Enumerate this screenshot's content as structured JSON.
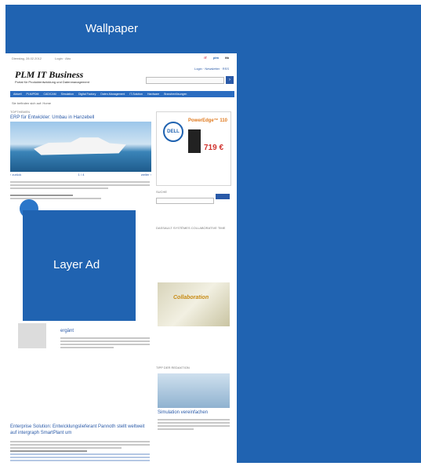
{
  "wallpaper": {
    "label": "Wallpaper"
  },
  "layer_ad": {
    "label": "Layer Ad"
  },
  "site": {
    "brand": "PLM IT Business",
    "tagline": "Portal für Produktentwicklung und Datenmanagement",
    "nav_items": [
      "Aktuell",
      "PLM/PDM",
      "CAD/CAM",
      "Simulation",
      "Digital Factory",
      "Daten-Management",
      "IT-Solution",
      "Hardware",
      "Branchenlösungen"
    ],
    "hero_section_label": "TOPTHEMEN",
    "hero_headline": "ERP für Entwickler: Umbau in Hanzebell",
    "enterprise_headline": "Enterprise Solution: Entwicklungslieferant Pannoth stellt weltweit auf intergraph SmartPlant um",
    "product_headline": "ergänt",
    "tipp_caption": "Simulation vereinfachen",
    "ad_dell": {
      "brand": "DELL",
      "product": "PowerEdge™ 110",
      "price": "719 €"
    },
    "suche_label": "SUCHE",
    "collaboration_label": "DASSAULT SYSTÈMES COLLABORATIVE TIME",
    "collaboration_word": "Collaboration",
    "tipp_label": "TIPP DER REDAKTION"
  },
  "colors": {
    "wallpaper": "#2063b1",
    "layer_ad": "#2063b1",
    "nav": "#2a6cc0",
    "link": "#2a5aa8"
  }
}
